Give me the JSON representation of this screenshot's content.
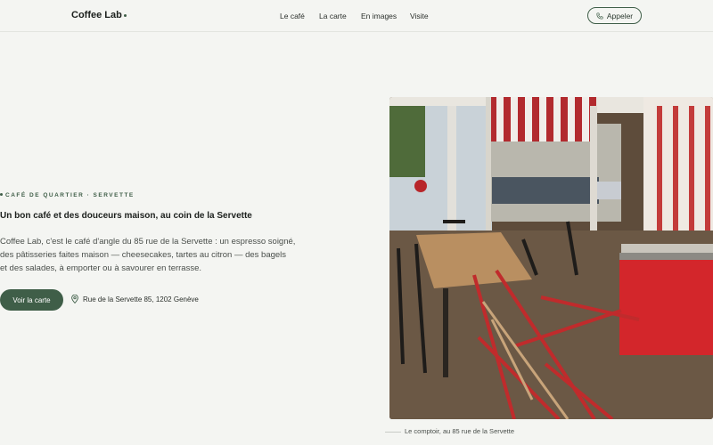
{
  "nav": {
    "brand": "Coffee Lab",
    "links": [
      "Le café",
      "La carte",
      "En images",
      "Visite"
    ],
    "call_label": "Appeler"
  },
  "hero": {
    "kicker": "CAFÉ DE QUARTIER · SERVETTE",
    "headline": "Un bon café et des douceurs maison, au coin de la Servette",
    "paragraph_lines": [
      "Coffee Lab, c'est le café d'angle du 85 rue de la Servette : un espresso soigné,",
      "des pâtisseries faites maison — cheesecakes, tartes au citron — des bagels",
      "et des salades, à emporter ou à savourer en terrasse."
    ],
    "cta_label": "Voir la carte",
    "address": "Rue de la Servette 85, 1202 Genève"
  },
  "photo": {
    "caption": "Le comptoir, au 85 rue de la Servette"
  },
  "colors": {
    "accent": "#3f5e48",
    "background": "#f4f5f2"
  }
}
